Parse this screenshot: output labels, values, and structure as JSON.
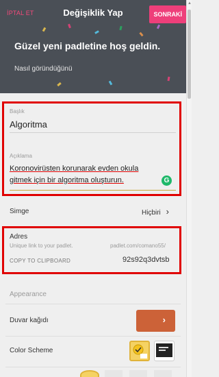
{
  "header": {
    "cancel_label": "İPTAL ET",
    "title": "Değişiklik Yap",
    "next_label": "SONRAKİ",
    "welcome": "Güzel yeni padletine hoş geldin.",
    "subtitle": "Nasıl göründüğünü"
  },
  "form": {
    "title_label": "Başlık",
    "title_value": "Algoritma",
    "description_label": "Açıklama",
    "description_line1": "Koronovirüsten korunarak evden okula",
    "description_line2": "gitmek için bir algoritma oluşturun."
  },
  "icon_row": {
    "label": "Simge",
    "value": "Hiçbiri",
    "chevron": "›"
  },
  "address": {
    "label": "Adres",
    "hint": "Unique link to your padlet.",
    "url_prefix": "padlet.com/comano55/",
    "copy_label": "COPY TO CLIPBOARD",
    "slug": "92s92q3dvtsb"
  },
  "appearance": {
    "heading": "Appearance",
    "wallpaper_label": "Duvar kağıdı",
    "wallpaper_chevron": "›",
    "scheme_label": "Color Scheme"
  },
  "colors": {
    "header_bg": "#4a4f56",
    "accent": "#ee3f7a",
    "highlight_border": "#e00000",
    "wallpaper": "#cc6238"
  },
  "icons": [
    "grammarly-icon",
    "chevron-right-icon",
    "check-icon"
  ]
}
